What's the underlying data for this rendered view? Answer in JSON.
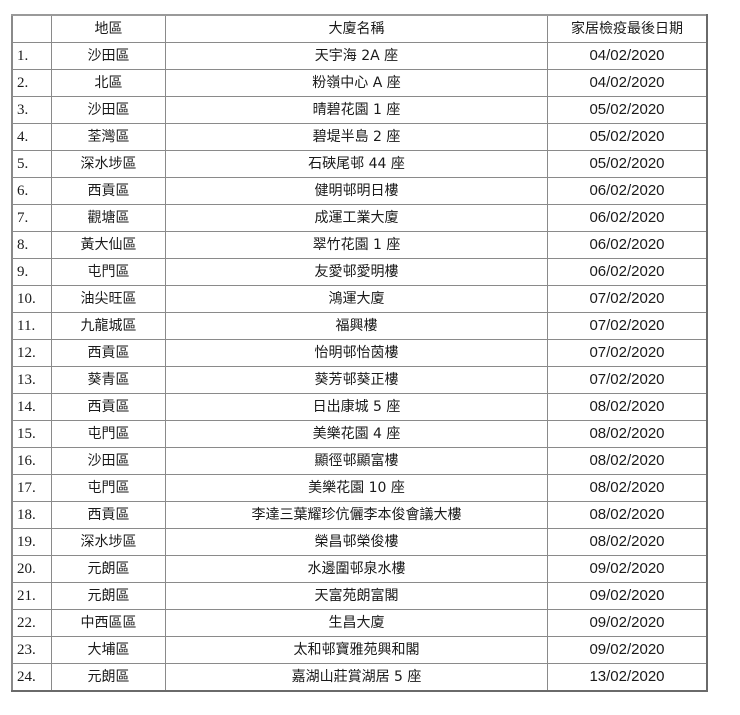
{
  "table": {
    "headers": {
      "no": "",
      "district": "地區",
      "building": "大廈名稱",
      "date": "家居檢疫最後日期"
    },
    "rows": [
      {
        "no": "1.",
        "district": "沙田區",
        "building": "天宇海 2A 座",
        "date": "04/02/2020"
      },
      {
        "no": "2.",
        "district": "北區",
        "building": "粉嶺中心 A 座",
        "date": "04/02/2020"
      },
      {
        "no": "3.",
        "district": "沙田區",
        "building": "晴碧花園 1 座",
        "date": "05/02/2020"
      },
      {
        "no": "4.",
        "district": "荃灣區",
        "building": "碧堤半島 2 座",
        "date": "05/02/2020"
      },
      {
        "no": "5.",
        "district": "深水埗區",
        "building": "石硤尾邨 44 座",
        "date": "05/02/2020"
      },
      {
        "no": "6.",
        "district": "西貢區",
        "building": "健明邨明日樓",
        "date": "06/02/2020"
      },
      {
        "no": "7.",
        "district": "觀塘區",
        "building": "成運工業大廈",
        "date": "06/02/2020"
      },
      {
        "no": "8.",
        "district": "黃大仙區",
        "building": "翠竹花園 1 座",
        "date": "06/02/2020"
      },
      {
        "no": "9.",
        "district": "屯門區",
        "building": "友愛邨愛明樓",
        "date": "06/02/2020"
      },
      {
        "no": "10.",
        "district": "油尖旺區",
        "building": "鴻運大廈",
        "date": "07/02/2020"
      },
      {
        "no": "11.",
        "district": "九龍城區",
        "building": "福興樓",
        "date": "07/02/2020"
      },
      {
        "no": "12.",
        "district": "西貢區",
        "building": "怡明邨怡茵樓",
        "date": "07/02/2020"
      },
      {
        "no": "13.",
        "district": "葵青區",
        "building": "葵芳邨葵正樓",
        "date": "07/02/2020"
      },
      {
        "no": "14.",
        "district": "西貢區",
        "building": "日出康城 5 座",
        "date": "08/02/2020"
      },
      {
        "no": "15.",
        "district": "屯門區",
        "building": "美樂花園 4 座",
        "date": "08/02/2020"
      },
      {
        "no": "16.",
        "district": "沙田區",
        "building": "顯徑邨顯富樓",
        "date": "08/02/2020"
      },
      {
        "no": "17.",
        "district": "屯門區",
        "building": "美樂花園  10 座",
        "date": "08/02/2020"
      },
      {
        "no": "18.",
        "district": "西貢區",
        "building": "李達三葉耀珍伉儷李本俊會議大樓",
        "date": "08/02/2020"
      },
      {
        "no": "19.",
        "district": "深水埗區",
        "building": "榮昌邨榮俊樓",
        "date": "08/02/2020"
      },
      {
        "no": "20.",
        "district": "元朗區",
        "building": "水邊圍邨泉水樓",
        "date": "09/02/2020"
      },
      {
        "no": "21.",
        "district": "元朗區",
        "building": "天富苑朗富閣",
        "date": "09/02/2020"
      },
      {
        "no": "22.",
        "district": "中西區區",
        "building": "生昌大廈",
        "date": "09/02/2020"
      },
      {
        "no": "23.",
        "district": "大埔區",
        "building": "太和邨寶雅苑興和閣",
        "date": "09/02/2020"
      },
      {
        "no": "24.",
        "district": "元朗區",
        "building": "嘉湖山莊賞湖居 5 座",
        "date": "13/02/2020"
      }
    ]
  }
}
